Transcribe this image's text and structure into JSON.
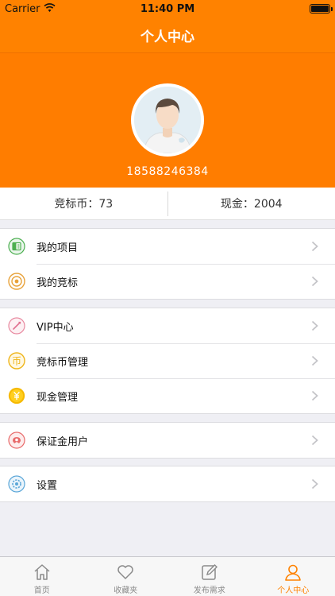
{
  "status_bar": {
    "carrier": "Carrier",
    "time": "11:40 PM"
  },
  "nav": {
    "title": "个人中心"
  },
  "profile": {
    "phone": "18588246384"
  },
  "balance": {
    "coins_label": "竞标币：73",
    "cash_label": "现金：2004"
  },
  "menu_groups": [
    [
      {
        "label": "我的项目",
        "icon": "project-icon"
      },
      {
        "label": "我的竞标",
        "icon": "bid-icon"
      }
    ],
    [
      {
        "label": "VIP中心",
        "icon": "vip-icon"
      },
      {
        "label": "竞标币管理",
        "icon": "coin-icon"
      },
      {
        "label": "现金管理",
        "icon": "yen-icon"
      }
    ],
    [
      {
        "label": "保证金用户",
        "icon": "deposit-icon"
      }
    ],
    [
      {
        "label": "设置",
        "icon": "gear-icon"
      }
    ]
  ],
  "tabs": [
    {
      "label": "首页",
      "icon": "home-icon"
    },
    {
      "label": "收藏夹",
      "icon": "heart-icon"
    },
    {
      "label": "发布需求",
      "icon": "edit-icon"
    },
    {
      "label": "个人中心",
      "icon": "person-icon",
      "active": true
    }
  ],
  "colors": {
    "brand": "#ff8200",
    "active_tab": "#ff8200"
  }
}
